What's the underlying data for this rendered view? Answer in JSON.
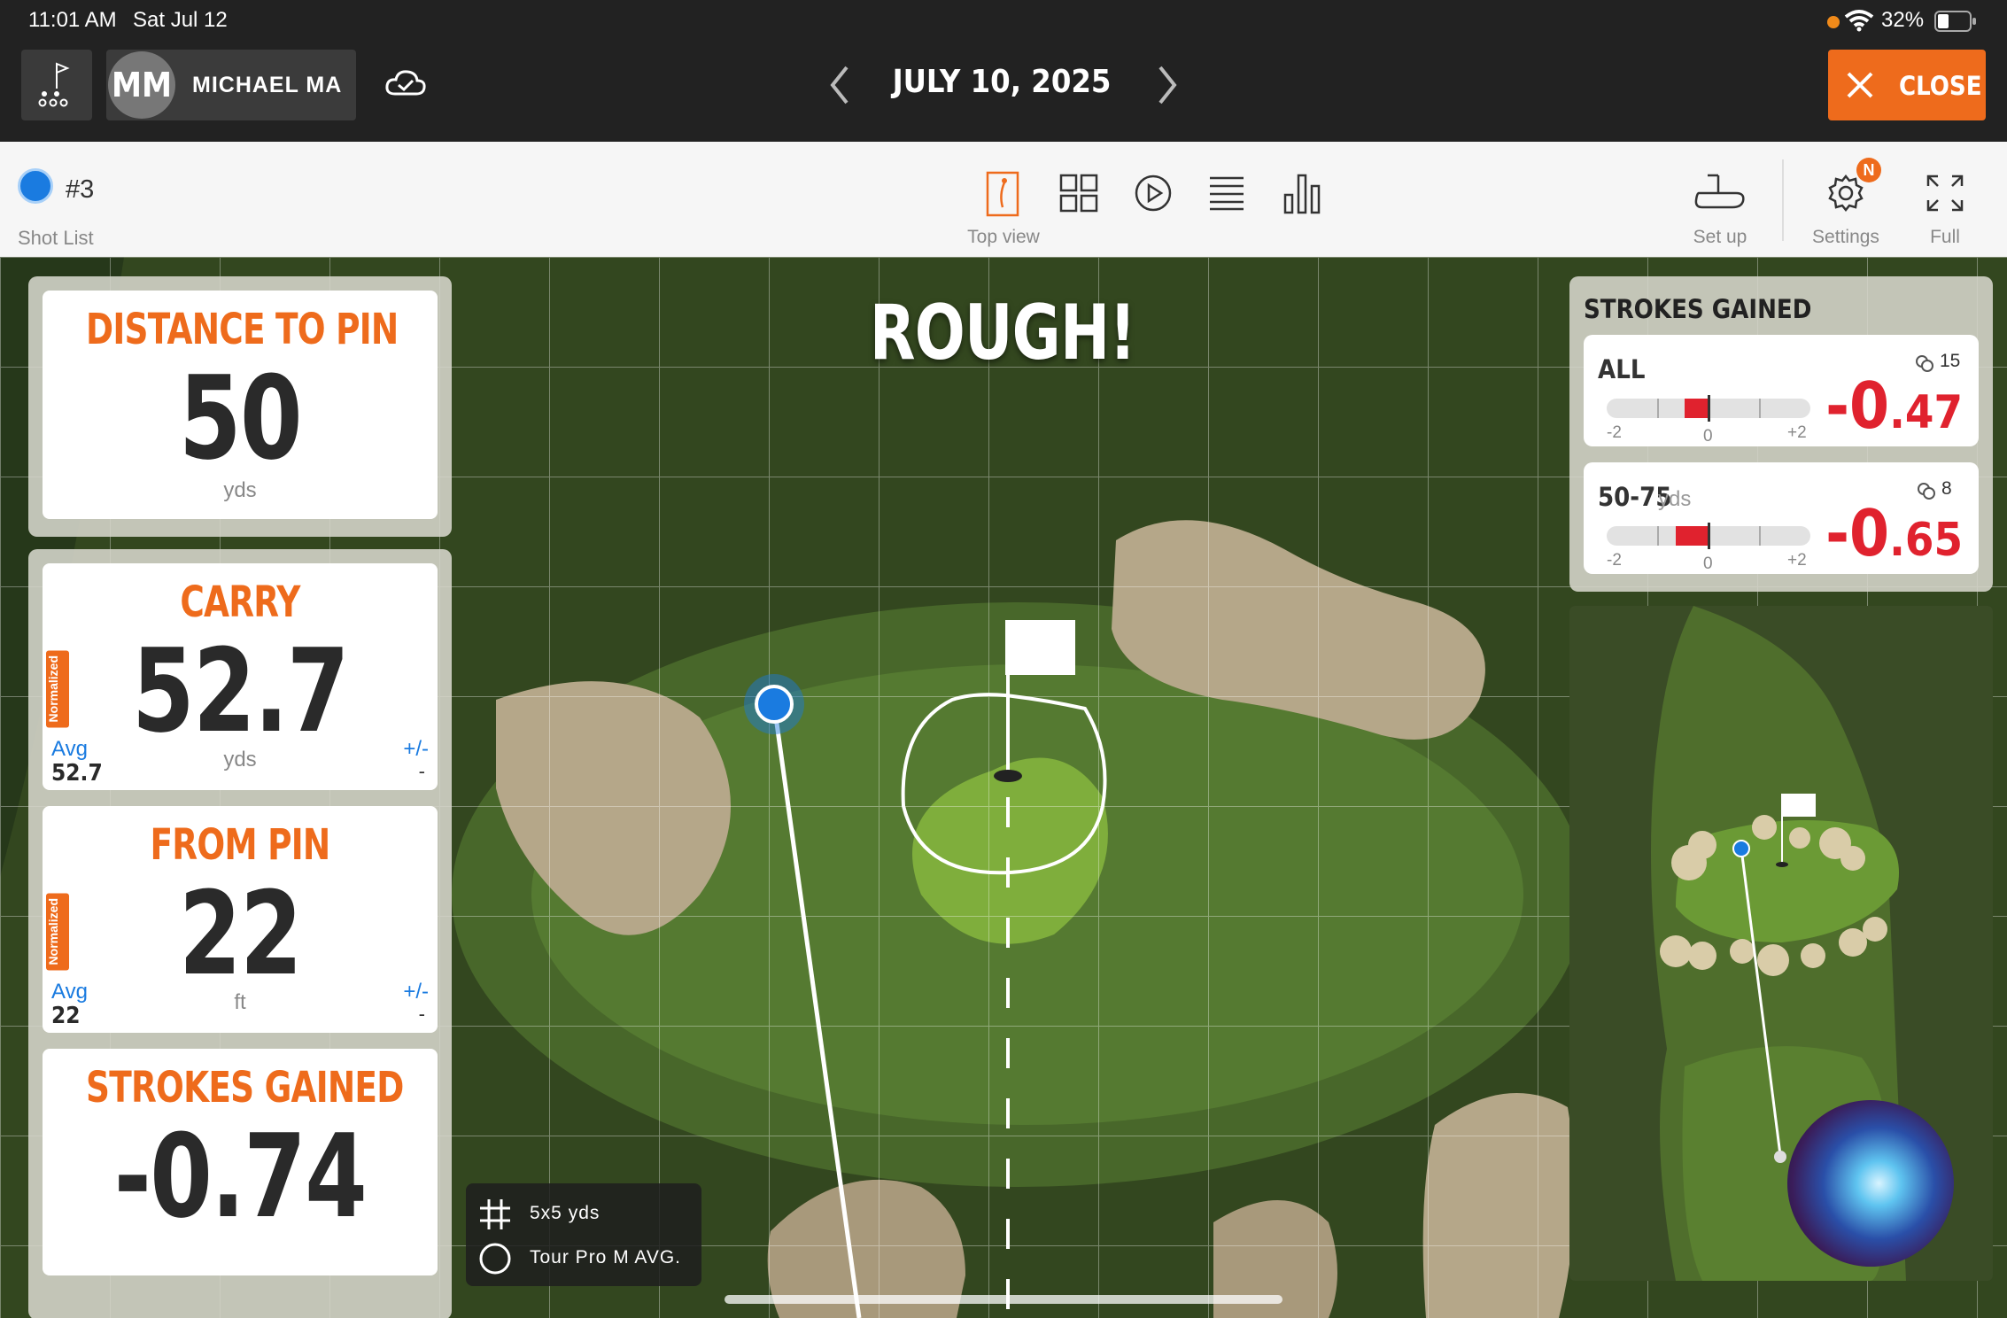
{
  "status_bar": {
    "time": "11:01 AM",
    "date": "Sat Jul 12",
    "battery": "32%"
  },
  "header": {
    "avatar_initials": "MM",
    "user_name": "MICHAEL MA",
    "date": "JULY 10, 2025",
    "close_label": "CLOSE"
  },
  "toolbar": {
    "shot_number": "#3",
    "shot_list_label": "Shot List",
    "top_view_label": "Top view",
    "setup_label": "Set up",
    "settings_label": "Settings",
    "settings_badge": "N",
    "full_label": "Full"
  },
  "result_banner": "ROUGH!",
  "stats": {
    "distance_to_pin": {
      "title": "DISTANCE TO PIN",
      "value": "50",
      "unit": "yds"
    },
    "carry": {
      "title": "CARRY",
      "value": "52.7",
      "unit": "yds",
      "tag": "Normalized",
      "avg_label": "Avg",
      "avg_value": "52.7",
      "pm_label": "+/-",
      "pm_value": "-"
    },
    "from_pin": {
      "title": "FROM PIN",
      "value": "22",
      "unit": "ft",
      "tag": "Normalized",
      "avg_label": "Avg",
      "avg_value": "22",
      "pm_label": "+/-",
      "pm_value": "-"
    },
    "strokes_gained": {
      "title": "STROKES GAINED",
      "value": "-0.74"
    }
  },
  "strokes_gained_panel": {
    "title": "STROKES GAINED",
    "rows": [
      {
        "label": "ALL",
        "sublabel": "",
        "count": "15",
        "value_int": "-0",
        "value_dec": ".47",
        "bar_value": -0.47,
        "scale_min": "-2",
        "scale_mid": "0",
        "scale_max": "+2"
      },
      {
        "label": "50-75",
        "sublabel": "yds",
        "count": "8",
        "value_int": "-0",
        "value_dec": ".65",
        "bar_value": -0.65,
        "scale_min": "-2",
        "scale_mid": "0",
        "scale_max": "+2"
      }
    ]
  },
  "legend": {
    "grid_label": "5x5 yds",
    "circle_label": "Tour Pro M AVG."
  },
  "colors": {
    "accent": "#ee6b1c",
    "negative": "#e0222e",
    "ball": "#1a7be0"
  }
}
